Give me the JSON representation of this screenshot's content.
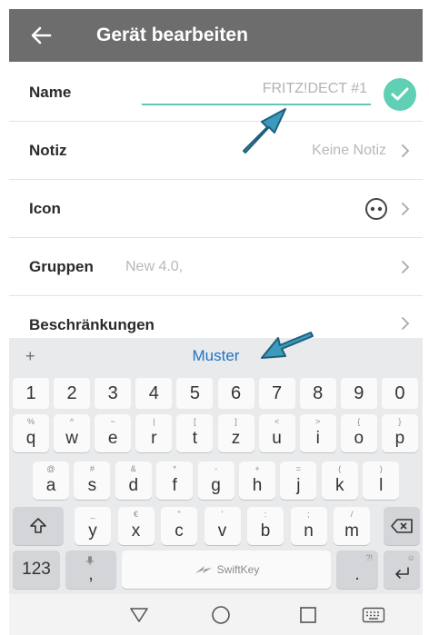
{
  "appbar": {
    "title": "Gerät bearbeiten",
    "back_icon": "arrow-left-icon"
  },
  "rows": {
    "name": {
      "label": "Name",
      "value": "FRITZ!DECT #1",
      "placeholder": "",
      "confirm_icon": "check-circle-icon"
    },
    "notiz": {
      "label": "Notiz",
      "value": "Keine Notiz"
    },
    "icon": {
      "label": "Icon",
      "glyph": "device-face-icon"
    },
    "gruppen": {
      "label": "Gruppen",
      "value": "New 4.0,"
    },
    "beschraenkungen": {
      "label": "Beschränkungen"
    }
  },
  "keyboard": {
    "suggestion_plus": "+",
    "suggestion": "Muster",
    "numbers": [
      "1",
      "2",
      "3",
      "4",
      "5",
      "6",
      "7",
      "8",
      "9",
      "0"
    ],
    "row1": [
      {
        "sec": "%",
        "pri": "q"
      },
      {
        "sec": "^",
        "pri": "w"
      },
      {
        "sec": "~",
        "pri": "e"
      },
      {
        "sec": "|",
        "pri": "r"
      },
      {
        "sec": "[",
        "pri": "t"
      },
      {
        "sec": "]",
        "pri": "z"
      },
      {
        "sec": "<",
        "pri": "u"
      },
      {
        "sec": ">",
        "pri": "i"
      },
      {
        "sec": "{",
        "pri": "o"
      },
      {
        "sec": "}",
        "pri": "p"
      }
    ],
    "row2": [
      {
        "sec": "@",
        "pri": "a"
      },
      {
        "sec": "#",
        "pri": "s"
      },
      {
        "sec": "&",
        "pri": "d"
      },
      {
        "sec": "*",
        "pri": "f"
      },
      {
        "sec": "-",
        "pri": "g"
      },
      {
        "sec": "+",
        "pri": "h"
      },
      {
        "sec": "=",
        "pri": "j"
      },
      {
        "sec": "(",
        "pri": "k"
      },
      {
        "sec": ")",
        "pri": "l"
      }
    ],
    "row3": [
      {
        "sec": "_",
        "pri": "y"
      },
      {
        "sec": "€",
        "pri": "x"
      },
      {
        "sec": "\"",
        "pri": "c"
      },
      {
        "sec": "'",
        "pri": "v"
      },
      {
        "sec": ":",
        "pri": "b"
      },
      {
        "sec": ";",
        "pri": "n"
      },
      {
        "sec": "/",
        "pri": "m"
      }
    ],
    "mode_key": "123",
    "comma_key": ",",
    "space_brand": "SwiftKey",
    "period_key": ".",
    "period_sec": "?!",
    "enter_sec": "☺"
  },
  "navbar": {
    "back": "triangle-back-icon",
    "home": "circle-home-icon",
    "recents": "square-recents-icon",
    "keyboard": "keyboard-icon"
  },
  "colors": {
    "appbar": "#6d6d6d",
    "accent": "#5fc8b8",
    "annotation": "#3a9bbd",
    "suggestion": "#1e73be"
  }
}
